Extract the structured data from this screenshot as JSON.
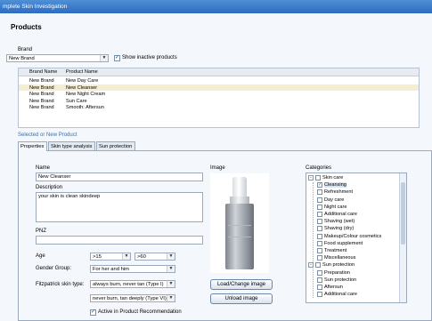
{
  "window": {
    "title": "mplete Skin Investigation"
  },
  "products": {
    "heading": "Products",
    "brand_label": "Brand",
    "brand_value": "New Brand",
    "show_inactive_label": "Show inactive products",
    "grid": {
      "columns": [
        "Brand Name",
        "Product Name"
      ],
      "rows": [
        [
          "New Brand",
          "New Day Care"
        ],
        [
          "New Brand",
          "New Cleanser"
        ],
        [
          "New Brand",
          "New Night Cream"
        ],
        [
          "New Brand",
          "Sun Care"
        ],
        [
          "New Brand",
          "Smooth: Aftersun"
        ]
      ]
    }
  },
  "detail": {
    "section_label": "Selected or New Product",
    "tabs": [
      "Properties",
      "Skin type analysis",
      "Sun protection"
    ],
    "name_label": "Name",
    "name_value": "New Cleanser",
    "description_label": "Description",
    "description_value": "your skin is clean skindeep",
    "pnz_label": "PNZ",
    "pnz_value": "",
    "age_label": "Age",
    "age_from": ">15",
    "age_to": ">60",
    "gender_label": "Gender Group:",
    "gender_value": "For her and him",
    "fitzpatrick_label": "Fitzpatrick skin type:",
    "fitzpatrick_from": "always burn, never tan (Type I)",
    "fitzpatrick_to": "never burn, tan deeply (Type VI)",
    "active_label": "Active in Product Recommendation",
    "image_label": "Image",
    "load_button": "Load/Change image",
    "unload_button": "Unload image",
    "categories_label": "Categories",
    "categories": [
      {
        "label": "Skin care",
        "level": 0,
        "expander": "-",
        "checked": false
      },
      {
        "label": "Cleansing",
        "level": 1,
        "checked": true
      },
      {
        "label": "Refreshment",
        "level": 1,
        "checked": false
      },
      {
        "label": "Day care",
        "level": 1,
        "checked": false
      },
      {
        "label": "Night care",
        "level": 1,
        "checked": false
      },
      {
        "label": "Additional care",
        "level": 1,
        "checked": false
      },
      {
        "label": "Shaving (wet)",
        "level": 1,
        "checked": false
      },
      {
        "label": "Shaving (dry)",
        "level": 1,
        "checked": false
      },
      {
        "label": "Makeup/Colour cosmetics",
        "level": 1,
        "checked": false
      },
      {
        "label": "Food supplement",
        "level": 1,
        "checked": false
      },
      {
        "label": "Treatment",
        "level": 1,
        "checked": false
      },
      {
        "label": "Miscellaneous",
        "level": 1,
        "checked": false
      },
      {
        "label": "Sun protection",
        "level": 0,
        "expander": "-",
        "checked": false
      },
      {
        "label": "Preparation",
        "level": 1,
        "checked": false
      },
      {
        "label": "Sun protection",
        "level": 1,
        "checked": false
      },
      {
        "label": "Aftersun",
        "level": 1,
        "checked": false
      },
      {
        "label": "Additional care",
        "level": 1,
        "checked": false
      }
    ]
  }
}
